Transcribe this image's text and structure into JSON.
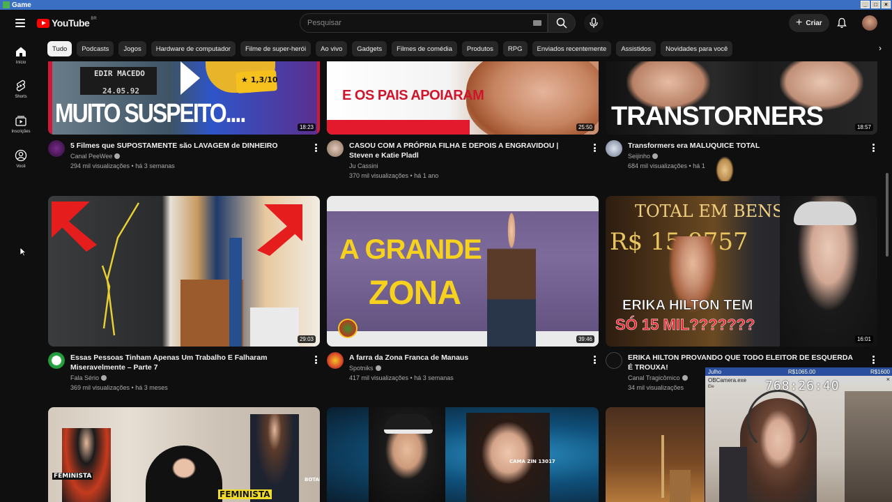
{
  "window": {
    "title": "Game"
  },
  "header": {
    "logo_text": "YouTube",
    "country_code": "BR",
    "search_placeholder": "Pesquisar",
    "create_label": "Criar"
  },
  "sidebar": {
    "items": [
      {
        "label": "Início",
        "icon": "home-icon"
      },
      {
        "label": "Shorts",
        "icon": "shorts-icon"
      },
      {
        "label": "Inscrições",
        "icon": "subscriptions-icon"
      },
      {
        "label": "Você",
        "icon": "you-icon"
      }
    ]
  },
  "chips": [
    "Tudo",
    "Podcasts",
    "Jogos",
    "Hardware de computador",
    "Filme de super-herói",
    "Ao vivo",
    "Gadgets",
    "Filmes de comédia",
    "Produtos",
    "RPG",
    "Enviados recentemente",
    "Assistidos",
    "Novidades para você"
  ],
  "videos": [
    {
      "title": "5 Filmes que SUPOSTAMENTE são LAVAGEM de DINHEIRO",
      "channel": "Canal PeeWee",
      "meta": "294 mil visualizações • há 3 semanas",
      "duration": "18:23",
      "thumb_text": [
        "EDIR MACEDO",
        "24.05.92",
        "MUITO SUSPEITO....",
        "1,3/10"
      ]
    },
    {
      "title": "CASOU COM A PRÓPRIA FILHA E DEPOIS A ENGRAVIDOU | Steven e Katie Pladl",
      "channel": "Ju Cassini",
      "meta": "370 mil visualizações • há 1 ano",
      "duration": "25:50",
      "thumb_text": [
        "E OS PAIS APOIARAM"
      ]
    },
    {
      "title": "Transformers era MALUQUICE TOTAL",
      "channel": "Seijinho",
      "meta": "684 mil visualizações • há 1",
      "duration": "18:57",
      "thumb_text": [
        "TRANSTORNERS"
      ]
    },
    {
      "title": "Essas Pessoas Tinham Apenas Um Trabalho E Falharam Miseravelmente – Parte 7",
      "channel": "Fala Sério",
      "meta": "369 mil visualizações • há 3 meses",
      "duration": "29:03",
      "thumb_text": []
    },
    {
      "title": "A farra da Zona Franca de Manaus",
      "channel": "Spotniks",
      "meta": "417 mil visualizações • há 3 semanas",
      "duration": "39:46",
      "thumb_text": [
        "A GRANDE",
        "ZONA"
      ]
    },
    {
      "title": "ERIKA HILTON PROVANDO QUE TODO ELEITOR DE ESQUERDA É TROUXA!",
      "channel": "Canal Tragicômico",
      "meta": "34 mil visualizações",
      "duration": "16:01",
      "thumb_text": [
        "TOTAL EM BENS:",
        "R$ 15.9757",
        "ERIKA HILTON TEM",
        "SÓ 15 MIL???????"
      ]
    },
    {
      "thumb_text": [
        "FEMINISTA",
        "FEMINISTA",
        "BOTAH"
      ]
    },
    {
      "thumb_text": [
        "CAMA ZIN 13017"
      ]
    },
    {
      "thumb_text": []
    }
  ],
  "overlay": {
    "bar_name": "Julho",
    "bar_mid": "R$1065.00",
    "bar_right": "R$1600",
    "cam_window_title": "OBCamera.exe",
    "cam_sub": "Ele",
    "timer": "768:26:40"
  }
}
